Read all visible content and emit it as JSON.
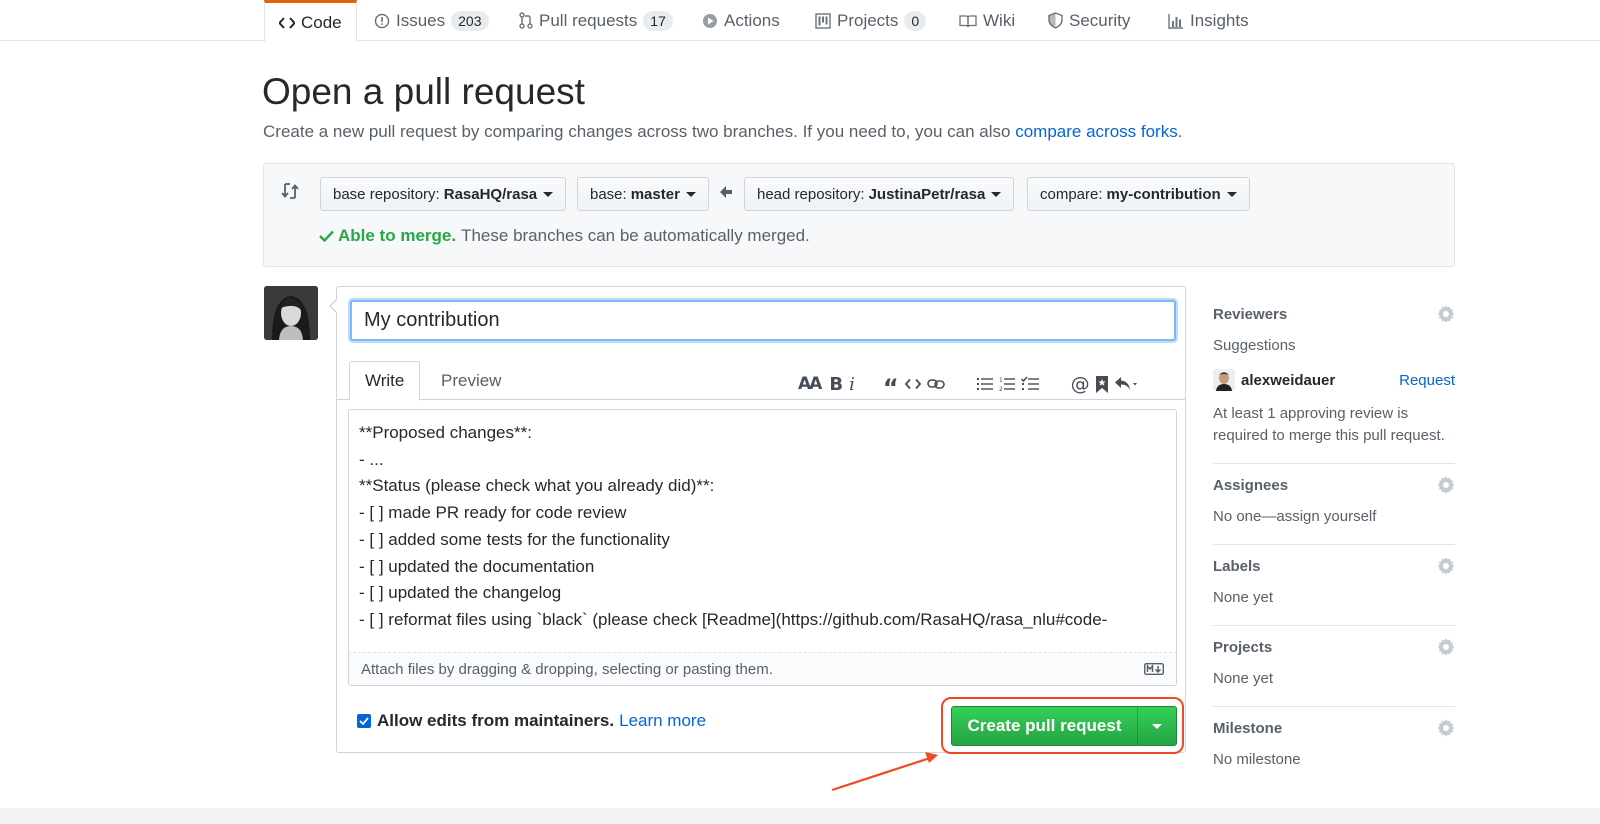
{
  "nav": {
    "tabs": [
      {
        "label": "Code",
        "icon": "code-icon"
      },
      {
        "label": "Issues",
        "count": "203",
        "icon": "issue-icon"
      },
      {
        "label": "Pull requests",
        "count": "17",
        "icon": "pull-request-icon"
      },
      {
        "label": "Actions",
        "icon": "play-icon"
      },
      {
        "label": "Projects",
        "count": "0",
        "icon": "project-icon"
      },
      {
        "label": "Wiki",
        "icon": "book-icon"
      },
      {
        "label": "Security",
        "icon": "shield-icon"
      },
      {
        "label": "Insights",
        "icon": "graph-icon"
      }
    ]
  },
  "header": {
    "title": "Open a pull request",
    "description": "Create a new pull request by comparing changes across two branches. If you need to, you can also ",
    "link": "compare across forks",
    "link_suffix": "."
  },
  "compare": {
    "base_repo_label": "base repository:",
    "base_repo_value": "RasaHQ/rasa",
    "base_label": "base:",
    "base_value": "master",
    "head_repo_label": "head repository:",
    "head_repo_value": "JustinaPetr/rasa",
    "compare_label": "compare:",
    "compare_value": "my-contribution",
    "merge_ok": "Able to merge.",
    "merge_msg": "These branches can be automatically merged."
  },
  "form": {
    "title_value": "My contribution",
    "tab_write": "Write",
    "tab_preview": "Preview",
    "toolbar_icons": [
      "text-size-icon",
      "bold-icon",
      "italic-icon",
      "quote-icon",
      "code-icon",
      "link-icon",
      "unordered-list-icon",
      "ordered-list-icon",
      "task-list-icon",
      "mention-icon",
      "bookmark-icon",
      "reply-icon"
    ],
    "body_lines": [
      "**Proposed changes**:",
      "- ...",
      "",
      "**Status (please check what you already did)**:",
      "- [ ] made PR ready for code review",
      "- [ ] added some tests for the functionality",
      "- [ ] updated the documentation",
      "- [ ] updated the changelog",
      "- [ ] reformat files using `black` (please check [Readme](https://github.com/RasaHQ/rasa_nlu#code-"
    ],
    "attach_text": "Attach files by dragging & dropping, selecting or pasting them.",
    "allow_edits_label": "Allow edits from maintainers.",
    "allow_edits_checked": true,
    "learn_more": "Learn more",
    "create_button": "Create pull request"
  },
  "sidebar": {
    "reviewers": {
      "title": "Reviewers",
      "suggestions": "Suggestions",
      "user": "alexweidauer",
      "request": "Request",
      "note": "At least 1 approving review is required to merge this pull request."
    },
    "assignees": {
      "title": "Assignees",
      "text": "No one—assign yourself"
    },
    "labels": {
      "title": "Labels",
      "text": "None yet"
    },
    "projects": {
      "title": "Projects",
      "text": "None yet"
    },
    "milestone": {
      "title": "Milestone",
      "text": "No milestone"
    }
  },
  "colors": {
    "accent_green": "#28a745",
    "link_blue": "#0366d6",
    "annotation_red": "#f04a25",
    "tab_orange": "#e36209"
  }
}
